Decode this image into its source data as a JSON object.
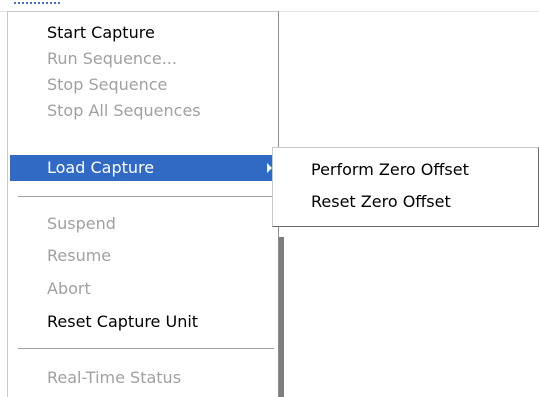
{
  "context_menu": {
    "items": [
      {
        "label": "Start Capture",
        "enabled": true
      },
      {
        "label": "Run Sequence...",
        "enabled": false
      },
      {
        "label": "Stop Sequence",
        "enabled": false
      },
      {
        "label": "Stop All Sequences",
        "enabled": false
      },
      {
        "label": "Load Capture",
        "enabled": true,
        "highlighted": true,
        "has_submenu": true
      }
    ],
    "items_group2": [
      {
        "label": "Suspend",
        "enabled": false
      },
      {
        "label": "Resume",
        "enabled": false
      },
      {
        "label": "Abort",
        "enabled": false
      },
      {
        "label": "Reset Capture Unit",
        "enabled": true
      }
    ],
    "items_group3": [
      {
        "label": "Real-Time Status",
        "enabled": false
      }
    ]
  },
  "submenu": {
    "items": [
      {
        "label": "Perform Zero Offset",
        "enabled": true
      },
      {
        "label": "Reset Zero Offset",
        "enabled": true
      }
    ]
  },
  "colors": {
    "highlight": "#316ac5",
    "disabled_text": "#a0a0a0",
    "enabled_text": "#000000"
  },
  "icons": {
    "submenu_arrow": "chevron-right-icon"
  }
}
